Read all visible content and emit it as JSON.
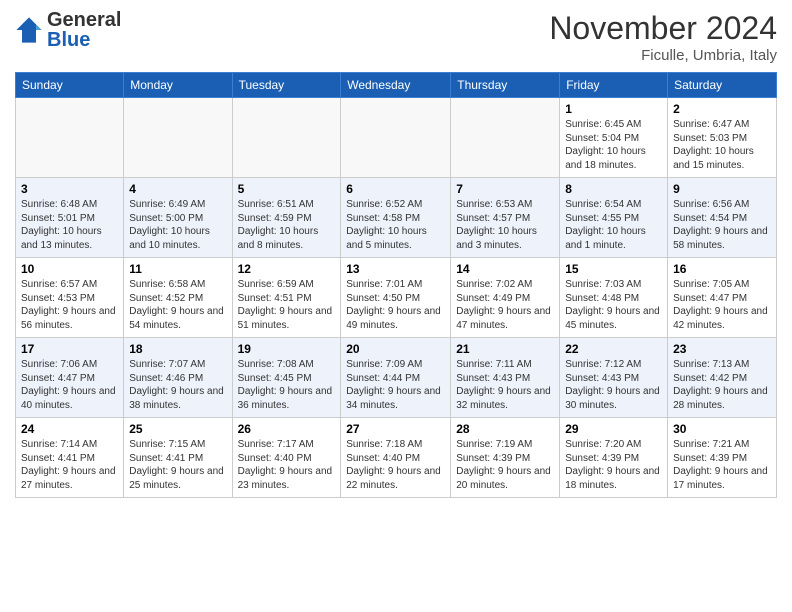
{
  "logo": {
    "general": "General",
    "blue": "Blue"
  },
  "title": "November 2024",
  "location": "Ficulle, Umbria, Italy",
  "headers": [
    "Sunday",
    "Monday",
    "Tuesday",
    "Wednesday",
    "Thursday",
    "Friday",
    "Saturday"
  ],
  "weeks": [
    [
      {
        "day": "",
        "info": ""
      },
      {
        "day": "",
        "info": ""
      },
      {
        "day": "",
        "info": ""
      },
      {
        "day": "",
        "info": ""
      },
      {
        "day": "",
        "info": ""
      },
      {
        "day": "1",
        "info": "Sunrise: 6:45 AM\nSunset: 5:04 PM\nDaylight: 10 hours and 18 minutes."
      },
      {
        "day": "2",
        "info": "Sunrise: 6:47 AM\nSunset: 5:03 PM\nDaylight: 10 hours and 15 minutes."
      }
    ],
    [
      {
        "day": "3",
        "info": "Sunrise: 6:48 AM\nSunset: 5:01 PM\nDaylight: 10 hours and 13 minutes."
      },
      {
        "day": "4",
        "info": "Sunrise: 6:49 AM\nSunset: 5:00 PM\nDaylight: 10 hours and 10 minutes."
      },
      {
        "day": "5",
        "info": "Sunrise: 6:51 AM\nSunset: 4:59 PM\nDaylight: 10 hours and 8 minutes."
      },
      {
        "day": "6",
        "info": "Sunrise: 6:52 AM\nSunset: 4:58 PM\nDaylight: 10 hours and 5 minutes."
      },
      {
        "day": "7",
        "info": "Sunrise: 6:53 AM\nSunset: 4:57 PM\nDaylight: 10 hours and 3 minutes."
      },
      {
        "day": "8",
        "info": "Sunrise: 6:54 AM\nSunset: 4:55 PM\nDaylight: 10 hours and 1 minute."
      },
      {
        "day": "9",
        "info": "Sunrise: 6:56 AM\nSunset: 4:54 PM\nDaylight: 9 hours and 58 minutes."
      }
    ],
    [
      {
        "day": "10",
        "info": "Sunrise: 6:57 AM\nSunset: 4:53 PM\nDaylight: 9 hours and 56 minutes."
      },
      {
        "day": "11",
        "info": "Sunrise: 6:58 AM\nSunset: 4:52 PM\nDaylight: 9 hours and 54 minutes."
      },
      {
        "day": "12",
        "info": "Sunrise: 6:59 AM\nSunset: 4:51 PM\nDaylight: 9 hours and 51 minutes."
      },
      {
        "day": "13",
        "info": "Sunrise: 7:01 AM\nSunset: 4:50 PM\nDaylight: 9 hours and 49 minutes."
      },
      {
        "day": "14",
        "info": "Sunrise: 7:02 AM\nSunset: 4:49 PM\nDaylight: 9 hours and 47 minutes."
      },
      {
        "day": "15",
        "info": "Sunrise: 7:03 AM\nSunset: 4:48 PM\nDaylight: 9 hours and 45 minutes."
      },
      {
        "day": "16",
        "info": "Sunrise: 7:05 AM\nSunset: 4:47 PM\nDaylight: 9 hours and 42 minutes."
      }
    ],
    [
      {
        "day": "17",
        "info": "Sunrise: 7:06 AM\nSunset: 4:47 PM\nDaylight: 9 hours and 40 minutes."
      },
      {
        "day": "18",
        "info": "Sunrise: 7:07 AM\nSunset: 4:46 PM\nDaylight: 9 hours and 38 minutes."
      },
      {
        "day": "19",
        "info": "Sunrise: 7:08 AM\nSunset: 4:45 PM\nDaylight: 9 hours and 36 minutes."
      },
      {
        "day": "20",
        "info": "Sunrise: 7:09 AM\nSunset: 4:44 PM\nDaylight: 9 hours and 34 minutes."
      },
      {
        "day": "21",
        "info": "Sunrise: 7:11 AM\nSunset: 4:43 PM\nDaylight: 9 hours and 32 minutes."
      },
      {
        "day": "22",
        "info": "Sunrise: 7:12 AM\nSunset: 4:43 PM\nDaylight: 9 hours and 30 minutes."
      },
      {
        "day": "23",
        "info": "Sunrise: 7:13 AM\nSunset: 4:42 PM\nDaylight: 9 hours and 28 minutes."
      }
    ],
    [
      {
        "day": "24",
        "info": "Sunrise: 7:14 AM\nSunset: 4:41 PM\nDaylight: 9 hours and 27 minutes."
      },
      {
        "day": "25",
        "info": "Sunrise: 7:15 AM\nSunset: 4:41 PM\nDaylight: 9 hours and 25 minutes."
      },
      {
        "day": "26",
        "info": "Sunrise: 7:17 AM\nSunset: 4:40 PM\nDaylight: 9 hours and 23 minutes."
      },
      {
        "day": "27",
        "info": "Sunrise: 7:18 AM\nSunset: 4:40 PM\nDaylight: 9 hours and 22 minutes."
      },
      {
        "day": "28",
        "info": "Sunrise: 7:19 AM\nSunset: 4:39 PM\nDaylight: 9 hours and 20 minutes."
      },
      {
        "day": "29",
        "info": "Sunrise: 7:20 AM\nSunset: 4:39 PM\nDaylight: 9 hours and 18 minutes."
      },
      {
        "day": "30",
        "info": "Sunrise: 7:21 AM\nSunset: 4:39 PM\nDaylight: 9 hours and 17 minutes."
      }
    ]
  ]
}
